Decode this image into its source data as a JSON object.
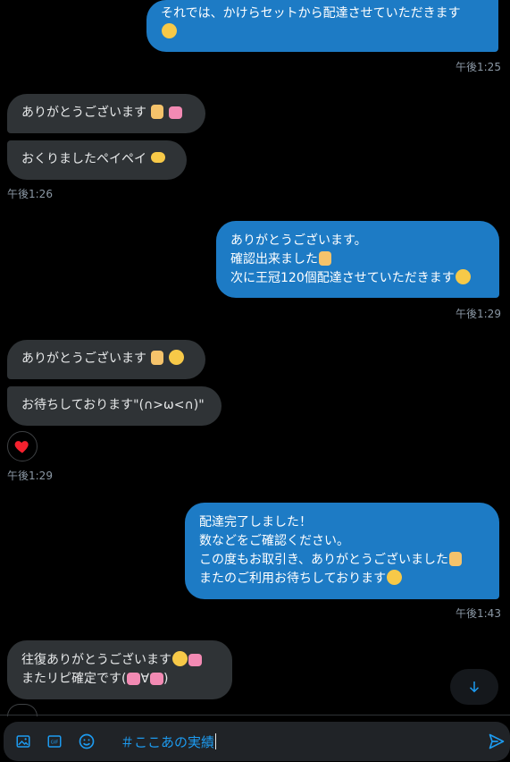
{
  "messages": [
    {
      "dir": "out",
      "lines": [
        "それでは、かけらセットから配達させていただきます"
      ],
      "time": "午後1:25"
    },
    {
      "dir": "in",
      "lines": [
        "ありがとうございます"
      ]
    },
    {
      "dir": "in",
      "lines": [
        "おくりましたペイペイ"
      ],
      "time": "午後1:26"
    },
    {
      "dir": "out",
      "lines": [
        "ありがとうございます。",
        "確認出来ました",
        "次に王冠120個配達させていただきます"
      ],
      "time": "午後1:29"
    },
    {
      "dir": "in",
      "lines": [
        "ありがとうございます"
      ]
    },
    {
      "dir": "in",
      "lines": [
        "お待ちしております\"(∩>ω<∩)\""
      ],
      "time": "午後1:29"
    },
    {
      "dir": "out",
      "lines": [
        "配達完了しました！",
        "数などをご確認ください。",
        "この度もお取引き、ありがとうございました",
        "またのご利用お待ちしております"
      ],
      "time": "午後1:43"
    },
    {
      "dir": "in",
      "lines": [
        "往復ありがとうございます",
        "またリピ確定です(",
        "∀",
        ")"
      ]
    }
  ],
  "composer": {
    "text": "＃ここあの実績",
    "icons": [
      "image-icon",
      "gif-icon",
      "emoji-icon",
      "send-icon"
    ]
  },
  "colors": {
    "outgoing": "#1d7bc5",
    "incoming": "#2f3336",
    "accent": "#1d9bf0",
    "background": "#000000"
  }
}
